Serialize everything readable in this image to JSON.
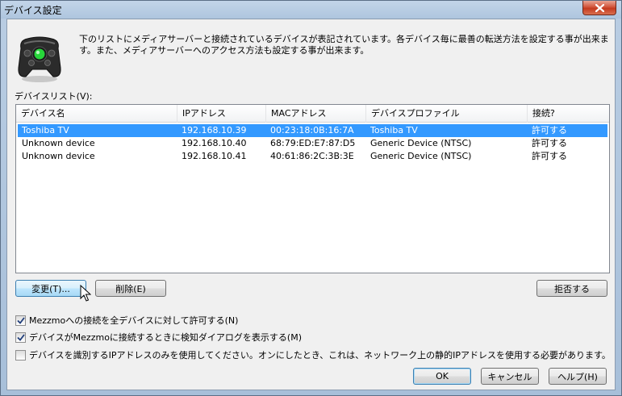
{
  "window": {
    "title": "デバイス設定"
  },
  "description": "下のリストにメディアサーバーと接続されているデバイスが表記されています。各デバイス毎に最善の転送方法を設定する事が出来ます。また、メディアサーバーへのアクセス方法も設定する事が出来ます。",
  "device_list": {
    "label": "デバイスリスト(V):",
    "columns": [
      "デバイス名",
      "IPアドレス",
      "MACアドレス",
      "デバイスプロファイル",
      "接続?"
    ],
    "rows": [
      [
        "Toshiba TV",
        "192.168.10.39",
        "00:23:18:0B:16:7A",
        "Toshiba TV",
        "許可する"
      ],
      [
        "Unknown device",
        "192.168.10.40",
        "68:79:ED:E7:87:D5",
        "Generic Device (NTSC)",
        "許可する"
      ],
      [
        "Unknown device",
        "192.168.10.41",
        "40:61:86:2C:3B:3E",
        "Generic Device (NTSC)",
        "許可する"
      ]
    ]
  },
  "buttons": {
    "change": "変更(T)...",
    "delete": "削除(E)",
    "deny": "拒否する",
    "ok": "OK",
    "cancel": "キャンセル",
    "help": "ヘルプ(H)"
  },
  "checkboxes": [
    {
      "label": "Mezzmoへの接続を全デバイスに対して許可する(N)",
      "checked": true
    },
    {
      "label": "デバイスがMezzmoに接続するときに検知ダイアログを表示する(M)",
      "checked": true
    },
    {
      "label": "デバイスを識別するIPアドレスのみを使用してください。オンにしたとき、これは、ネットワーク上の静的IPアドレスを使用する必要があります。",
      "checked": false
    }
  ],
  "colors": {
    "selection": "#3399ff",
    "gamepad_button": "#27d63a"
  }
}
